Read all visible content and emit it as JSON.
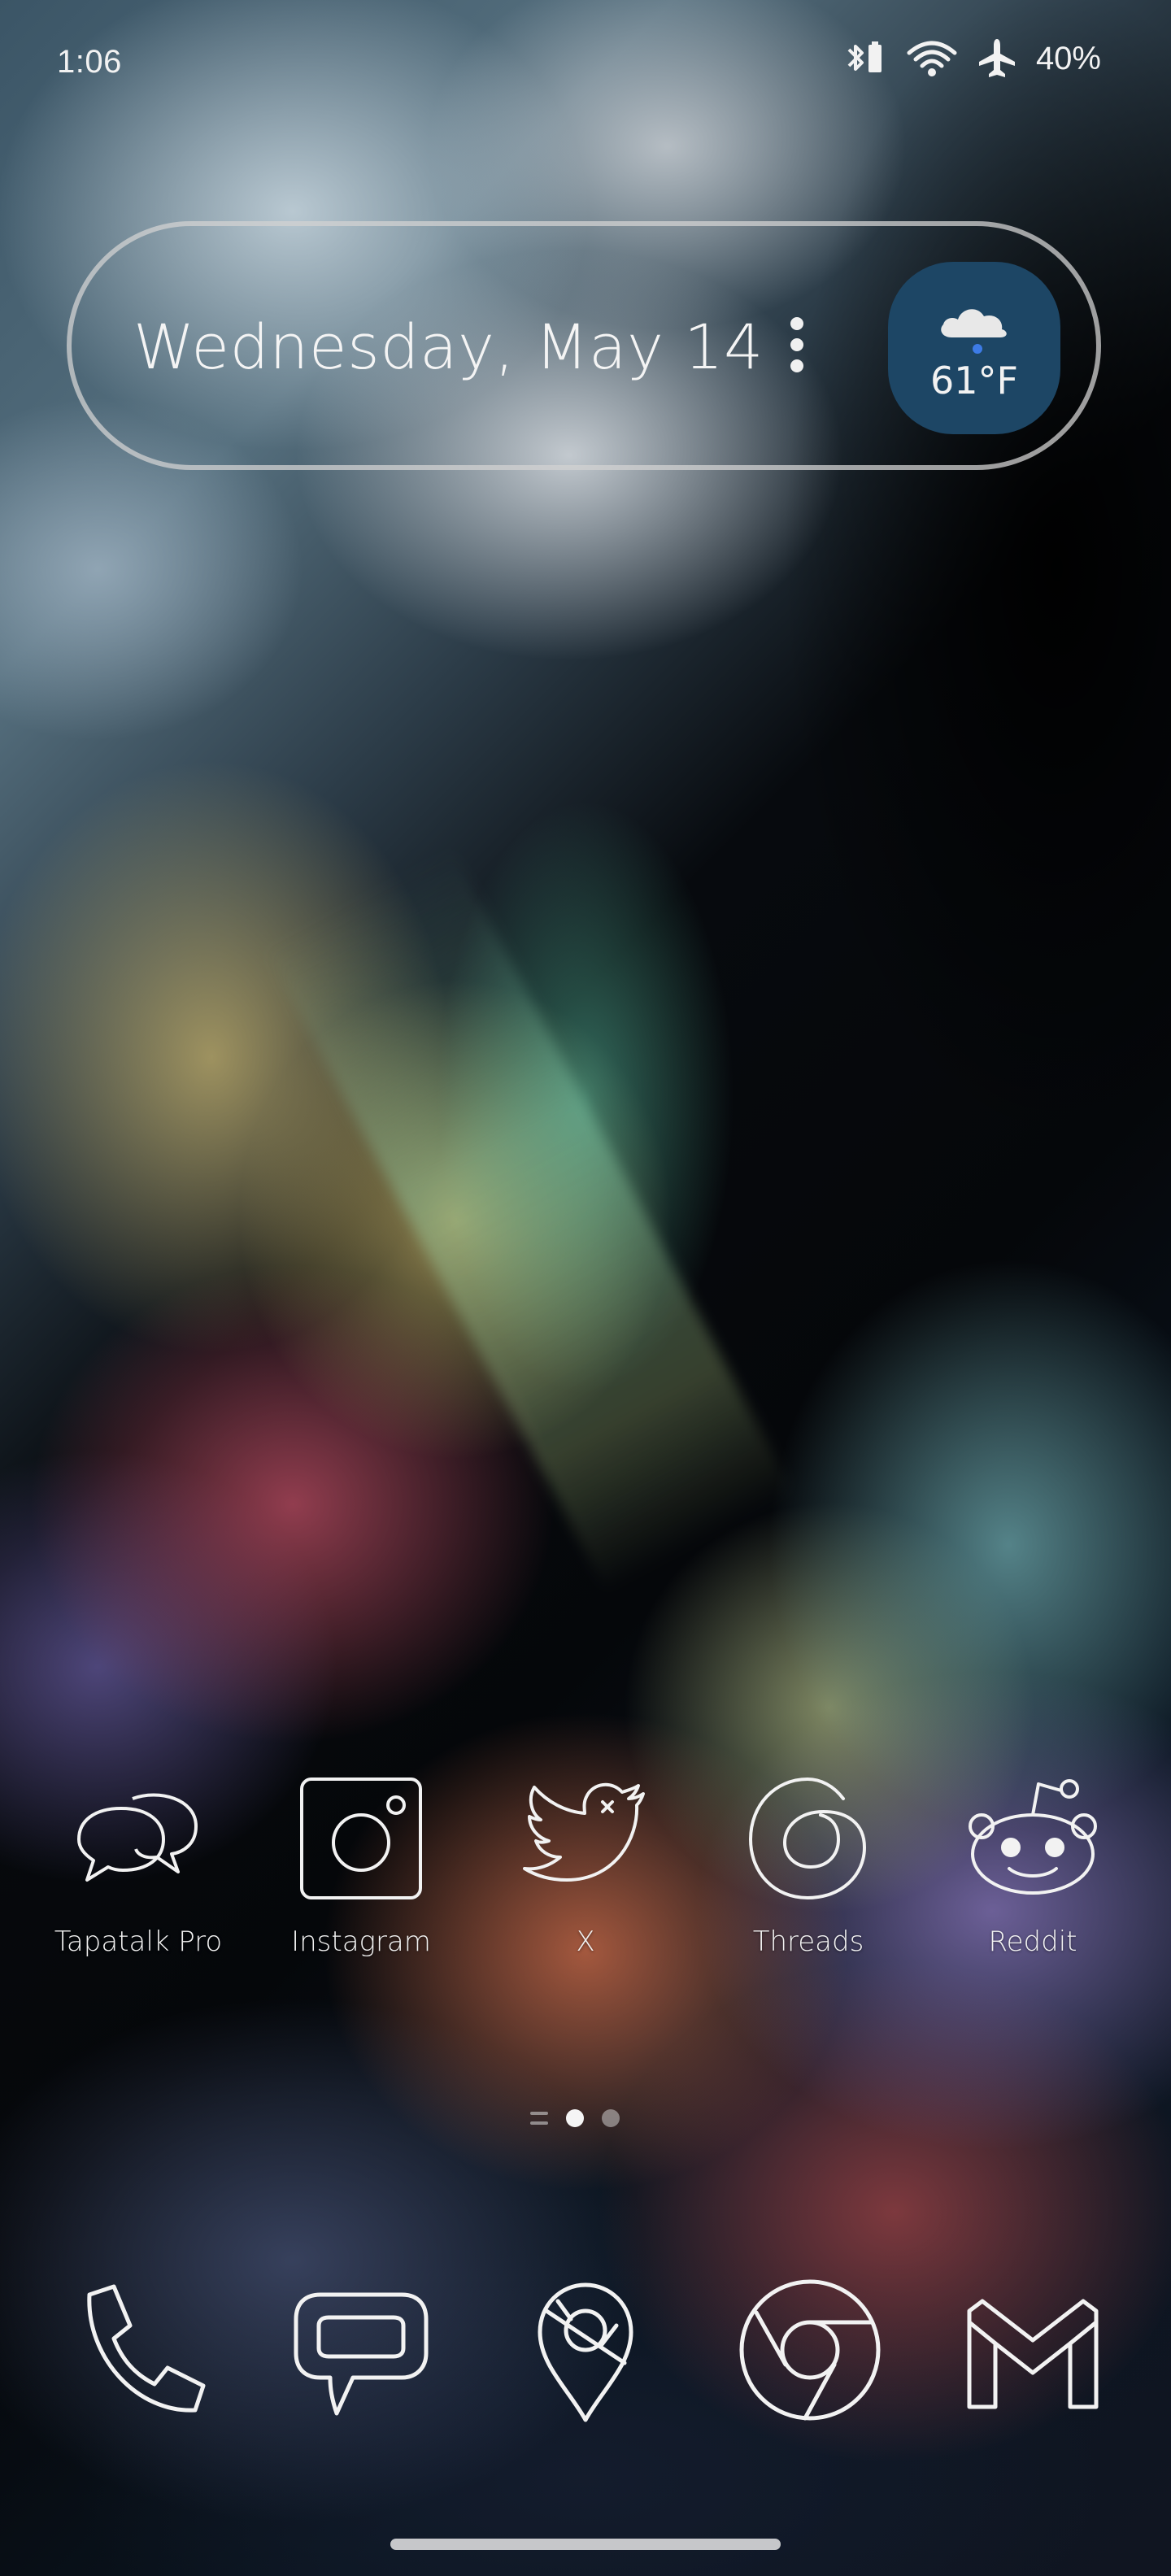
{
  "status_bar": {
    "time": "1:06",
    "battery": "40%",
    "icons": [
      "bluetooth-battery-icon",
      "wifi-icon",
      "airplane-mode-icon"
    ]
  },
  "date_widget": {
    "date": "Wednesday, May 14",
    "weather": {
      "temperature": "61°F",
      "icon": "cloud-rain-icon",
      "chip_color": "#1d4665"
    }
  },
  "apps": [
    {
      "label": "Tapatalk Pro",
      "icon": "chat-bubbles-icon"
    },
    {
      "label": "Instagram",
      "icon": "instagram-icon"
    },
    {
      "label": "X",
      "icon": "twitter-bird-icon"
    },
    {
      "label": "Threads",
      "icon": "threads-icon"
    },
    {
      "label": "Reddit",
      "icon": "reddit-icon"
    }
  ],
  "page_indicator": {
    "pages": 2,
    "active": 1
  },
  "dock": [
    {
      "icon": "phone-icon"
    },
    {
      "icon": "messages-icon"
    },
    {
      "icon": "maps-icon"
    },
    {
      "icon": "chrome-icon"
    },
    {
      "icon": "gmail-icon"
    }
  ]
}
